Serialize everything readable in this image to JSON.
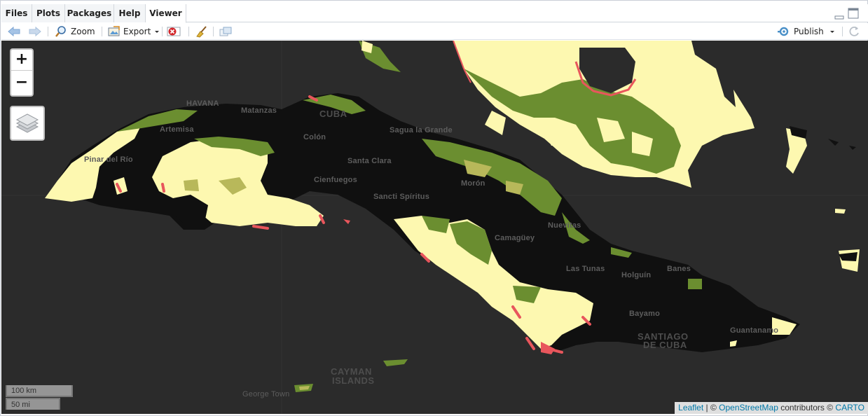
{
  "tabs": [
    {
      "label": "Files",
      "active": false
    },
    {
      "label": "Plots",
      "active": false
    },
    {
      "label": "Packages",
      "active": false
    },
    {
      "label": "Help",
      "active": false
    },
    {
      "label": "Viewer",
      "active": true
    }
  ],
  "toolbar": {
    "zoom_label": "Zoom",
    "export_label": "Export",
    "publish_label": "Publish"
  },
  "map": {
    "zoom_in": "+",
    "zoom_out": "−",
    "scale_km": "100 km",
    "scale_mi": "50 mi",
    "attribution": {
      "leaflet": "Leaflet",
      "sep": " | © ",
      "osm": "OpenStreetMap",
      "contrib": " contributors © ",
      "carto": "CARTO"
    },
    "place_labels": {
      "havana": "HAVANA",
      "matanzas": "Matanzas",
      "cuba": "CUBA",
      "artemisa": "Artemisa",
      "colon": "Colón",
      "sagua": "Sagua la Grande",
      "pinar": "Pinar del Río",
      "santa_clara": "Santa Clara",
      "cienfuegos": "Cienfuegos",
      "moron": "Morón",
      "sancti": "Sancti Spíritus",
      "nuevitas": "Nuevitas",
      "camaguey": "Camagüey",
      "las_tunas": "Las Tunas",
      "holguin": "Holguín",
      "banes": "Banes",
      "bayamo": "Bayamo",
      "santiago1": "SANTIAGO",
      "santiago2": "DE CUBA",
      "guantanamo": "Guantanamo",
      "cayman1": "CAYMAN",
      "cayman2": "ISLANDS",
      "george_town": "George Town"
    },
    "colors": {
      "ocean": "#2b2b2b",
      "land_dark": "#101010",
      "class_yellow": "#fdf8b0",
      "class_green": "#6b8e30",
      "class_olive": "#b8b85a",
      "class_red": "#e8565c"
    }
  }
}
